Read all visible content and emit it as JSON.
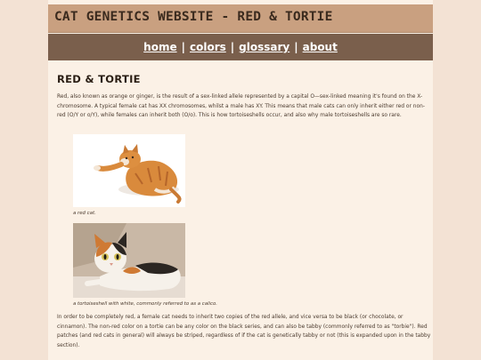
{
  "site_title": "CAT GENETICS WEBSITE - RED & TORTIE",
  "nav": {
    "home": "home",
    "colors": "colors",
    "glossary": "glossary",
    "about": "about",
    "separator": "|"
  },
  "page_title": "RED & TORTIE",
  "intro_paragraph": "Red, also known as orange or ginger, is the result of a sex-linked allele represented by a capital O—sex-linked meaning it's found on the X-chromosome. A typical female cat has XX chromosomes, whilst a male has XY. This means that male cats can only inherit either red or non-red (O/Y or o/Y), while females can inherit both (O/o). This is how tortoiseshells occur, and also why male tortoiseshells are so rare.",
  "images": [
    {
      "caption": "a red cat.",
      "icon": "red-cat-photo"
    },
    {
      "caption": "a tortoiseshell with white, commonly referred to as a calico.",
      "icon": "calico-cat-photo"
    }
  ],
  "second_paragraph": "In order to be completely red, a female cat needs to inherit two copies of the red allele, and vice versa to be black (or chocolate, or cinnamon). The non-red color on a tortie can be any color on the black series, and can also be tabby (commonly referred to as \"torbie\"). Red patches (and red cats in general) will always be striped, regardless of if the cat is genetically tabby or not (this is expanded upon in the tabby section).",
  "colors": {
    "background": "#f3e2d4",
    "header": "#c9a080",
    "nav": "#7a5f4c",
    "content": "#fbf1e6"
  }
}
